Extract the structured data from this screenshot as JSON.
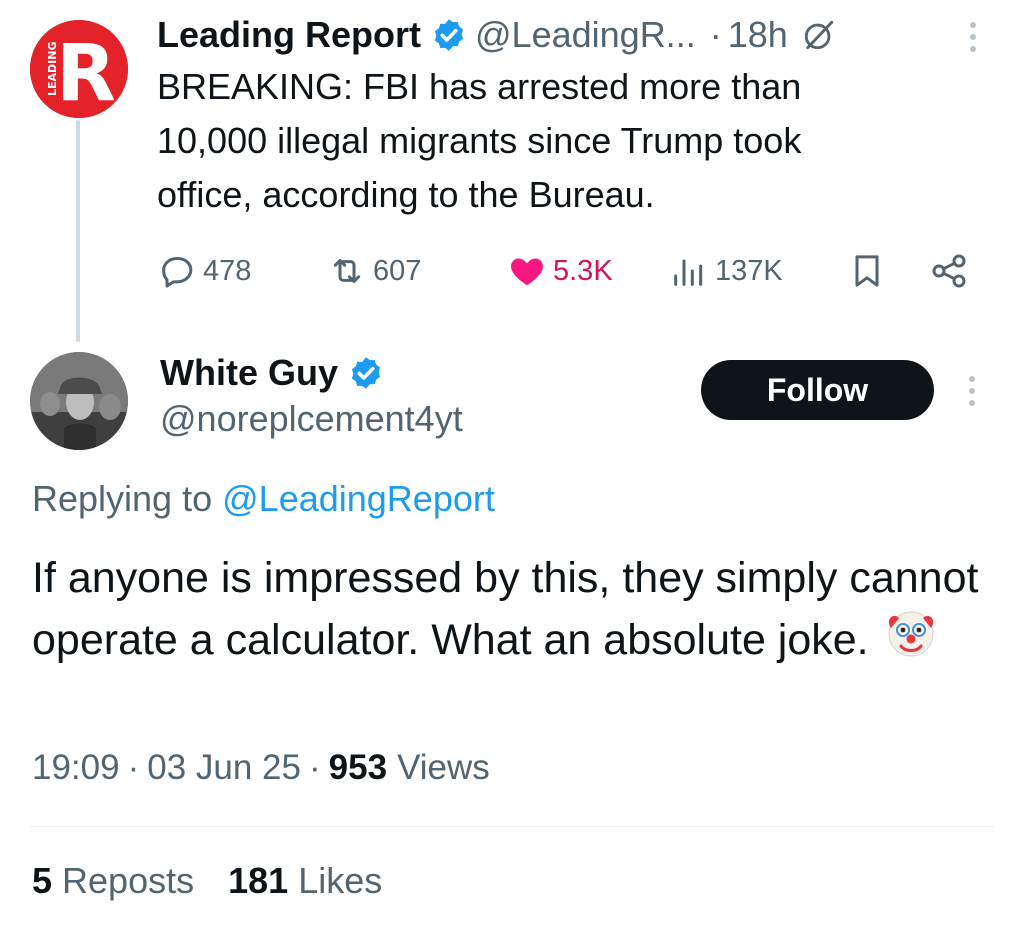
{
  "parent_tweet": {
    "display_name": "Leading Report",
    "handle": "@LeadingR...",
    "dot": "·",
    "time": "18h",
    "avatar_letter": "R",
    "avatar_side_text": "LEADING",
    "text": "BREAKING: FBI has arrested more than\n10,000 illegal migrants since Trump took\noffice, according to the Bureau.",
    "actions": {
      "replies": "478",
      "reposts": "607",
      "likes": "5.3K",
      "views": "137K"
    },
    "colors": {
      "avatar_bg": "#e42229",
      "like": "#d5135a",
      "verified": "#1d9bf0"
    }
  },
  "reply_tweet": {
    "display_name": "White Guy",
    "handle": "@noreplcement4yt",
    "follow_label": "Follow",
    "replying_prefix": "Replying to",
    "replying_mention": "@LeadingReport",
    "text": "If anyone is impressed by this, they simply cannot operate a calculator. What an absolute joke.",
    "emoji_icon": "clown-face-icon",
    "time": "19:09",
    "date": "03 Jun 25",
    "meta_sep": "·",
    "views_count": "953",
    "views_label": "Views",
    "reposts_count": "5",
    "reposts_label": "Reposts",
    "likes_count": "181",
    "likes_label": "Likes"
  }
}
